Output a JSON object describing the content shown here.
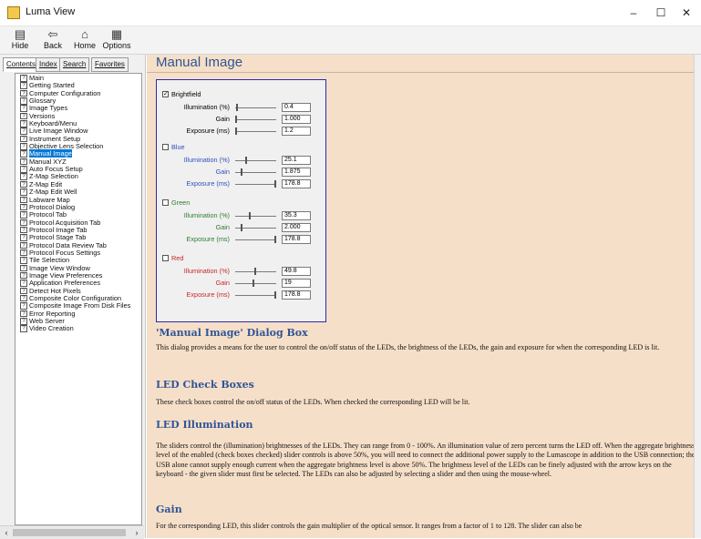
{
  "window": {
    "title": "Luma View",
    "minimize": "–",
    "maximize": "☐",
    "close": "✕"
  },
  "toolbar": {
    "hide": "Hide",
    "back": "Back",
    "home": "Home",
    "options": "Options"
  },
  "nav": {
    "tabs": [
      "Contents",
      "Index",
      "Search",
      "Favorites"
    ],
    "active_tab": "Contents",
    "items": [
      "Main",
      "Getting Started",
      "Computer Configuration",
      "Glossary",
      "Image Types",
      "Versions",
      "Keyboard/Menu",
      "Live Image Window",
      "Instrument Setup",
      "Objective Lens Selection",
      "Manual Image",
      "Manual XYZ",
      "Auto Focus Setup",
      "Z-Map Selection",
      "Z-Map Edit",
      "Z-Map Edit Well",
      "Labware Map",
      "Protocol Dialog",
      "Protocol Tab",
      "Protocol Acquisition Tab",
      "Protocol Image Tab",
      "Protocol Stage Tab",
      "Protocol Data Review Tab",
      "Protocol Focus Settings",
      "Tile Selection",
      "Image View Window",
      "Image View Preferences",
      "Application Preferences",
      "Detect Hot Pixels",
      "Composite Color Configuration",
      "Composite Image From Disk Files",
      "Error Reporting",
      "Web Server",
      "Video Creation"
    ],
    "selected_index": 10,
    "scroll_left": "‹",
    "scroll_right": "›"
  },
  "content": {
    "title": "Manual Image",
    "dialog": {
      "groups": [
        {
          "name": "Brightfield",
          "checked": true,
          "color": "#000000",
          "rows": [
            {
              "label": "Illumination (%)",
              "value": "0.4",
              "thumb": 0.02
            },
            {
              "label": "Gain",
              "value": "1.000",
              "thumb": 0.0
            },
            {
              "label": "Exposure (ms)",
              "value": "1.2",
              "thumb": 0.0
            }
          ]
        },
        {
          "name": "Blue",
          "checked": false,
          "color": "#2f4fbf",
          "rows": [
            {
              "label": "Illumination (%)",
              "value": "25.1",
              "thumb": 0.251
            },
            {
              "label": "Gain",
              "value": "1.875",
              "thumb": 0.15
            },
            {
              "label": "Exposure (ms)",
              "value": "178.8",
              "thumb": 1.0
            }
          ]
        },
        {
          "name": "Green",
          "checked": false,
          "color": "#2e7d32",
          "rows": [
            {
              "label": "Illumination (%)",
              "value": "35.3",
              "thumb": 0.353
            },
            {
              "label": "Gain",
              "value": "2.000",
              "thumb": 0.15
            },
            {
              "label": "Exposure (ms)",
              "value": "178.8",
              "thumb": 1.0
            }
          ]
        },
        {
          "name": "Red",
          "checked": false,
          "color": "#c62828",
          "rows": [
            {
              "label": "Illumination (%)",
              "value": "49.8",
              "thumb": 0.498
            },
            {
              "label": "Gain",
              "value": "19",
              "thumb": 0.45
            },
            {
              "label": "Exposure (ms)",
              "value": "178.8",
              "thumb": 1.0
            }
          ]
        }
      ]
    },
    "sections": [
      {
        "heading": "'Manual Image' Dialog Box",
        "text": "This dialog provides a means for the user to control the on/off status of the LEDs, the brightness of the LEDs, the gain and exposure for when the corresponding LED is lit."
      },
      {
        "heading": "LED Check Boxes",
        "text": "These check boxes control the on/off status of the LEDs. When checked the corresponding LED will be lit."
      },
      {
        "heading": "LED Illumination",
        "text": "The sliders control the (illumination) brightnesses of the LEDs. They can range from 0 - 100%. An illumination value of zero percent turns the LED off. When the aggregate brightness level of the enabled (check boxes checked) slider controls is above 50%, you will need to connect the additional power supply to the Lumascope in addition to the USB connection; the USB alone cannot supply enough current when the aggregate brightness level is above 50%. The brightness level of the LEDs can be finely adjusted with the arrow keys on the keyboard - the given slider must first be selected. The LEDs can also be adjusted by selecting a slider and then using the mouse-wheel."
      },
      {
        "heading": "Gain",
        "text": "For the corresponding LED, this slider controls the gain multiplier of the optical sensor. It ranges from a factor of 1 to 128. The slider can also be"
      }
    ]
  },
  "colors": {
    "content_bg": "#f6dfc9",
    "heading": "#2f5596",
    "selection": "#0078d7"
  }
}
